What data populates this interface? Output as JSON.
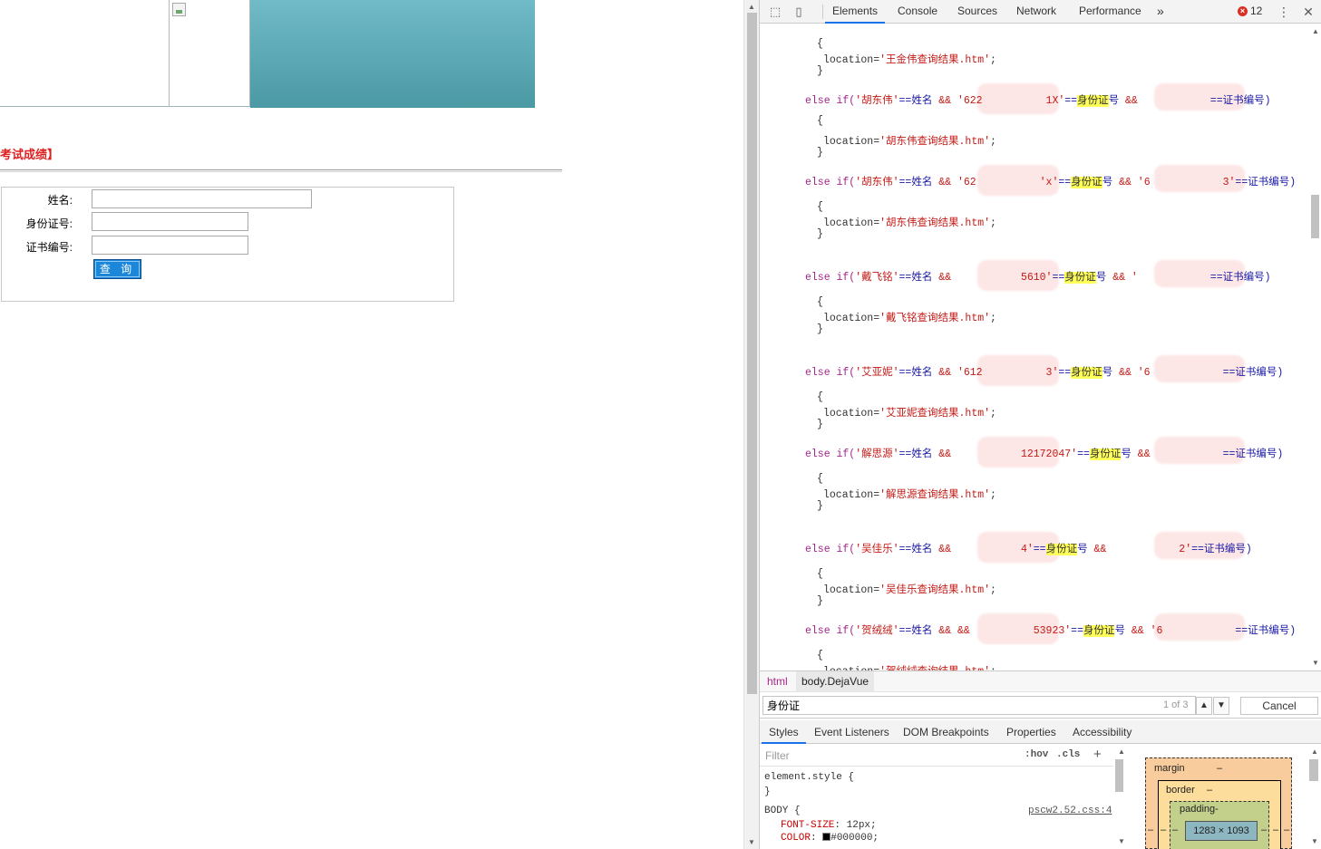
{
  "page": {
    "section_title": "考试成绩】",
    "form": {
      "name_label": "姓名:",
      "id_label": "身份证号:",
      "cert_label": "证书编号:",
      "name_value": "",
      "id_value": "",
      "cert_value": "",
      "submit_label": "查 询"
    }
  },
  "devtools": {
    "tabs": [
      "Elements",
      "Console",
      "Sources",
      "Network",
      "Performance"
    ],
    "more_tabs_icon": "»",
    "error_count": "12",
    "code_lines": [
      {
        "type": "brace",
        "text": "{"
      },
      {
        "type": "loc",
        "name": "王金伟"
      },
      {
        "type": "brace",
        "text": "}"
      },
      {
        "type": "cond",
        "name": "胡东伟",
        "id_frag": "'622",
        "id_tail": "1X'",
        "cert_frag": "&&",
        "cert_tail": ""
      },
      {
        "type": "brace",
        "text": "{"
      },
      {
        "type": "loc",
        "name": "胡东伟"
      },
      {
        "type": "brace",
        "text": "}"
      },
      {
        "type": "cond",
        "name": "胡东伟",
        "id_frag": "'62",
        "id_tail": "'x'",
        "cert_frag": "&& '6",
        "cert_tail": "3'"
      },
      {
        "type": "brace",
        "text": "{"
      },
      {
        "type": "loc",
        "name": "胡东伟"
      },
      {
        "type": "brace",
        "text": "}"
      },
      {
        "type": "cond",
        "name": "戴飞铭",
        "id_frag": "",
        "id_tail": "5610'",
        "cert_frag": "&& '",
        "cert_tail": ""
      },
      {
        "type": "brace",
        "text": "{"
      },
      {
        "type": "loc",
        "name": "戴飞铭"
      },
      {
        "type": "brace",
        "text": "}"
      },
      {
        "type": "cond",
        "name": "艾亚妮",
        "id_frag": "'612",
        "id_tail": "3'",
        "cert_frag": "&& '6",
        "cert_tail": ""
      },
      {
        "type": "brace",
        "text": "{"
      },
      {
        "type": "loc",
        "name": "艾亚妮"
      },
      {
        "type": "brace",
        "text": "}"
      },
      {
        "type": "cond",
        "name": "解思源",
        "id_frag": "",
        "id_tail": "12172047'",
        "cert_frag": "&&",
        "cert_tail": ""
      },
      {
        "type": "brace",
        "text": "{"
      },
      {
        "type": "loc",
        "name": "解思源"
      },
      {
        "type": "brace",
        "text": "}"
      },
      {
        "type": "cond",
        "name": "吴佳乐",
        "id_frag": "",
        "id_tail": "4'",
        "cert_frag": "&&",
        "cert_tail": "2'"
      },
      {
        "type": "brace",
        "text": "{"
      },
      {
        "type": "loc",
        "name": "吴佳乐"
      },
      {
        "type": "brace",
        "text": "}"
      },
      {
        "type": "cond",
        "name": "贺绒绒",
        "id_frag": "&&",
        "id_tail": "53923'",
        "cert_frag": "&& '6",
        "cert_tail": ""
      },
      {
        "type": "brace",
        "text": "{"
      },
      {
        "type": "loc",
        "name": "贺绒绒"
      }
    ],
    "code_tokens": {
      "else_if": "else if(",
      "eq_name": "'==姓名 ",
      "and": "&& ",
      "eq": "==",
      "id_field": "身份证",
      "id_suffix": "号",
      "cert_field": "==证书编号)",
      "loc_prefix": "location='",
      "loc_suffix": "查询结果.htm';"
    },
    "breadcrumbs": [
      "html",
      "body.DejaVue"
    ],
    "search": {
      "value": "身份证",
      "match_count": "1 of 3",
      "cancel_label": "Cancel"
    },
    "subtabs": [
      "Styles",
      "Event Listeners",
      "DOM Breakpoints",
      "Properties",
      "Accessibility"
    ],
    "styles": {
      "filter_placeholder": "Filter",
      "hov": ":hov",
      "cls": ".cls",
      "element_style": "element.style {",
      "close_brace": "}",
      "body_selector": "BODY {",
      "source": "pscw2.52.css:4",
      "props": [
        {
          "name": "FONT-SIZE",
          "value": "12px;"
        },
        {
          "name": "COLOR",
          "value": "#000000;"
        }
      ]
    },
    "box_model": {
      "margin_label": "margin",
      "border_label": "border",
      "padding_label": "padding-",
      "dash": "–",
      "content_size": "1283 × 1093"
    }
  }
}
